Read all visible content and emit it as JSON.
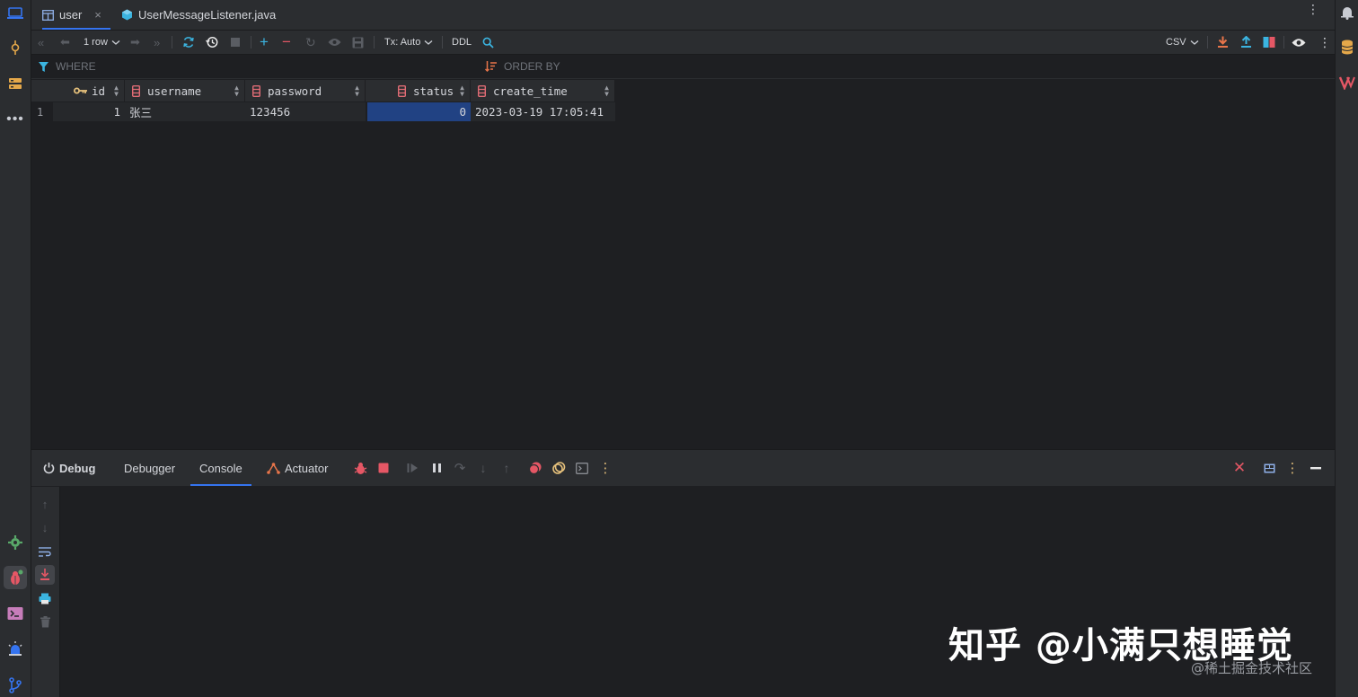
{
  "tabs": [
    {
      "label": "user",
      "icon": "table-icon",
      "active": true,
      "close": "×"
    },
    {
      "label": "UserMessageListener.java",
      "icon": "java-class-icon",
      "active": false
    }
  ],
  "toolbar": {
    "rows_label": "1 row",
    "tx_label": "Tx: Auto",
    "ddl_label": "DDL",
    "format_label": "CSV"
  },
  "filter": {
    "where_label": "WHERE",
    "order_label": "ORDER BY"
  },
  "table": {
    "columns": [
      {
        "name": "id",
        "icon": "primary-key-icon"
      },
      {
        "name": "username",
        "icon": "column-icon"
      },
      {
        "name": "password",
        "icon": "column-icon"
      },
      {
        "name": "status",
        "icon": "column-icon"
      },
      {
        "name": "create_time",
        "icon": "column-icon"
      }
    ],
    "rows": [
      {
        "num": "1",
        "cells": [
          "1",
          "张三",
          "123456",
          "0",
          "2023-03-19 17:05:41"
        ]
      }
    ],
    "selected_cell": {
      "row": 0,
      "column": "status"
    }
  },
  "debug": {
    "title": "Debug",
    "tabs": [
      {
        "label": "Debugger",
        "active": false
      },
      {
        "label": "Console",
        "active": true
      },
      {
        "label": "Actuator",
        "active": false
      }
    ]
  },
  "watermark": {
    "main": "知乎 @小满只想睡觉",
    "sub": "@稀土掘金技术社区"
  },
  "colors": {
    "accent": "#3574f0",
    "selection": "#214283",
    "stop_red": "#e55765",
    "column_icon": "#e06c75",
    "key_icon": "#e5c07b"
  }
}
